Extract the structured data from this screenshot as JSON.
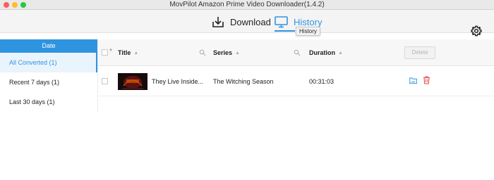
{
  "window": {
    "title": "MovPilot Amazon Prime Video Downloader(1.4.2)"
  },
  "toolbar": {
    "download_label": "Download",
    "history_label": "History",
    "tooltip": "History"
  },
  "sidebar": {
    "header": "Date",
    "items": [
      {
        "label": "All Converted (1)",
        "active": true
      },
      {
        "label": "Recent 7 days (1)",
        "active": false
      },
      {
        "label": "Last 30 days (1)",
        "active": false
      }
    ]
  },
  "table": {
    "columns": {
      "title": "Title",
      "series": "Series",
      "duration": "Duration"
    },
    "delete_label": "Delete",
    "rows": [
      {
        "title": "They Live Inside...",
        "series": "The Witching Season",
        "duration": "00:31:03"
      }
    ]
  },
  "colors": {
    "accent": "#2f94e0",
    "delete_icon": "#e0443e"
  }
}
